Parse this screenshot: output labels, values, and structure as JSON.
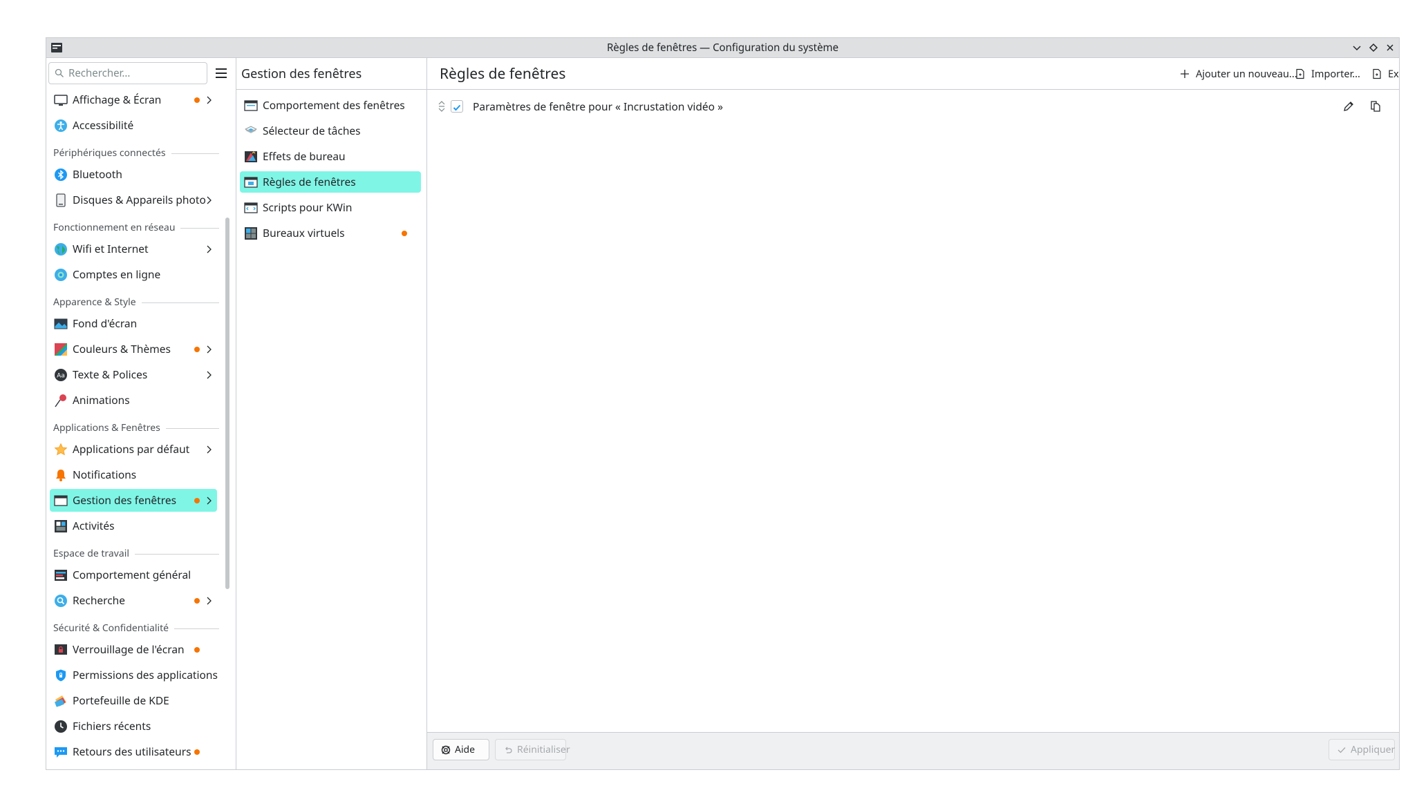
{
  "window": {
    "title": "Règles de fenêtres — Configuration du système"
  },
  "sidebar": {
    "search_placeholder": "Rechercher...",
    "items": [
      {
        "type": "item",
        "label": "Affichage & Écran",
        "icon": "display-icon",
        "dot": true,
        "chevron": true
      },
      {
        "type": "item",
        "label": "Accessibilité",
        "icon": "accessibility-icon"
      },
      {
        "type": "section",
        "label": "Périphériques connectés"
      },
      {
        "type": "item",
        "label": "Bluetooth",
        "icon": "bluetooth-icon"
      },
      {
        "type": "item",
        "label": "Disques & Appareils photo",
        "icon": "drive-icon",
        "chevron": true
      },
      {
        "type": "section",
        "label": "Fonctionnement en réseau"
      },
      {
        "type": "item",
        "label": "Wifi et Internet",
        "icon": "globe-icon",
        "chevron": true
      },
      {
        "type": "item",
        "label": "Comptes en ligne",
        "icon": "online-accounts-icon"
      },
      {
        "type": "section",
        "label": "Apparence & Style"
      },
      {
        "type": "item",
        "label": "Fond d'écran",
        "icon": "wallpaper-icon"
      },
      {
        "type": "item",
        "label": "Couleurs & Thèmes",
        "icon": "colors-icon",
        "dot": true,
        "chevron": true
      },
      {
        "type": "item",
        "label": "Texte & Polices",
        "icon": "fonts-icon",
        "chevron": true
      },
      {
        "type": "item",
        "label": "Animations",
        "icon": "animations-icon"
      },
      {
        "type": "section",
        "label": "Applications & Fenêtres"
      },
      {
        "type": "item",
        "label": "Applications par défaut",
        "icon": "star-icon",
        "chevron": true
      },
      {
        "type": "item",
        "label": "Notifications",
        "icon": "bell-icon"
      },
      {
        "type": "item",
        "label": "Gestion des fenêtres",
        "icon": "window-icon",
        "dot": true,
        "chevron": true,
        "active": true
      },
      {
        "type": "item",
        "label": "Activités",
        "icon": "activities-icon"
      },
      {
        "type": "section",
        "label": "Espace de travail"
      },
      {
        "type": "item",
        "label": "Comportement général",
        "icon": "general-behavior-icon"
      },
      {
        "type": "item",
        "label": "Recherche",
        "icon": "search-circle-icon",
        "dot": true,
        "chevron": true
      },
      {
        "type": "section",
        "label": "Sécurité & Confidentialité"
      },
      {
        "type": "item",
        "label": "Verrouillage de l'écran",
        "icon": "lock-screen-icon",
        "dot": true
      },
      {
        "type": "item",
        "label": "Permissions des applications",
        "icon": "shield-icon"
      },
      {
        "type": "item",
        "label": "Portefeuille de KDE",
        "icon": "wallet-icon"
      },
      {
        "type": "item",
        "label": "Fichiers récents",
        "icon": "clock-icon"
      },
      {
        "type": "item",
        "label": "Retours des utilisateurs",
        "icon": "feedback-icon",
        "dot": true
      }
    ]
  },
  "middle": {
    "title": "Gestion des fenêtres",
    "items": [
      {
        "label": "Comportement des fenêtres",
        "icon": "window-behavior-icon"
      },
      {
        "label": "Sélecteur de tâches",
        "icon": "task-switcher-icon"
      },
      {
        "label": "Effets de bureau",
        "icon": "desktop-effects-icon"
      },
      {
        "label": "Règles de fenêtres",
        "icon": "window-rules-icon",
        "active": true
      },
      {
        "label": "Scripts pour KWin",
        "icon": "kwin-scripts-icon"
      },
      {
        "label": "Bureaux virtuels",
        "icon": "virtual-desktops-icon",
        "dot": true
      }
    ]
  },
  "main": {
    "title": "Règles de fenêtres",
    "add_label": "Ajouter un nouveau...",
    "import_label": "Importer...",
    "export_label": "Exporter...",
    "rules": [
      {
        "label": "Paramètres de fenêtre pour « Incrustation vidéo »",
        "checked": true
      }
    ],
    "footer": {
      "help_label": "Aide",
      "reset_label": "Réinitialiser",
      "apply_label": "Appliquer"
    }
  },
  "colors": {
    "accent": "#7ff5e6",
    "dot": "#f67400",
    "check": "#1d99f3",
    "delete": "#da4453"
  }
}
